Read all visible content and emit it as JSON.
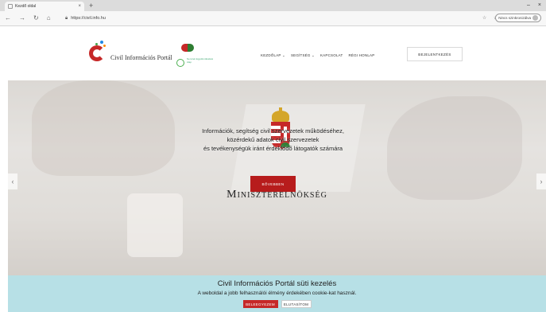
{
  "browser": {
    "tab_title": "Kezdő oldal",
    "tab_close": "×",
    "new_tab": "+",
    "url": "https://civil.info.hu",
    "nav_back": "←",
    "nav_forward": "→",
    "nav_reload": "↻",
    "nav_home": "⌂",
    "sync_label": "Nincs szinkronizálva",
    "window_minimize": "–",
    "window_close": "×"
  },
  "header": {
    "logo_text": "Civil Információs Portál",
    "partner_text": "Nemzeti Együttműködési Alap",
    "nav": [
      {
        "label": "KEZDŐLAP ⌄"
      },
      {
        "label": "SEGÍTSÉG ⌄"
      },
      {
        "label": "KAPCSOLAT"
      },
      {
        "label": "RÉGI HONLAP"
      }
    ],
    "login_label": "BEJELENTKEZÉS"
  },
  "hero": {
    "title": "Miniszterelnökség",
    "lines": [
      "Információk, segítség civil szervezetek működéséhez,",
      "közérdekű adatok civil szervezetek",
      "és tevékenységük iránt érdeklődő látogatók számára"
    ],
    "more_label": "BŐVEBBEN",
    "arrow_left": "‹",
    "arrow_right": "›"
  },
  "cookie": {
    "title": "Civil Információs Portál süti kezelés",
    "text": "A weboldal a jobb felhasználói élmény érdekében cookie-kat használ.",
    "accept_label": "BELEEGYEZEM",
    "reject_label": "ELUTASÍTOM"
  },
  "colors": {
    "brand_red": "#c62828",
    "cookie_bg": "#b7e0e6"
  }
}
